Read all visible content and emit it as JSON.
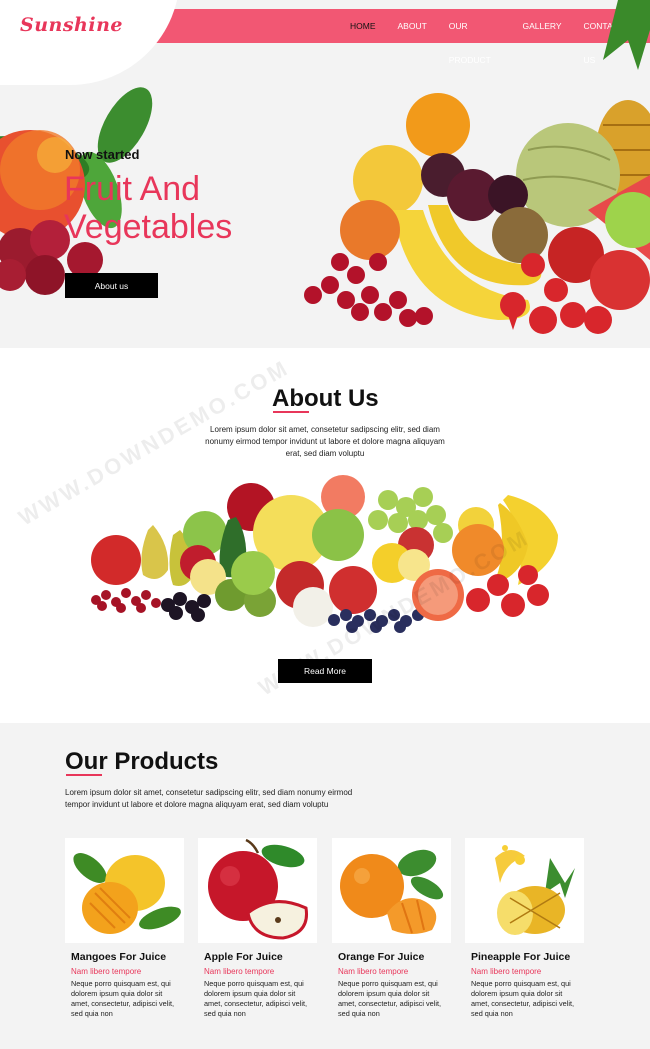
{
  "brand": {
    "logo": "Sunshine"
  },
  "nav": {
    "items": [
      {
        "label": "HOME",
        "active": true
      },
      {
        "label": "ABOUT",
        "active": false
      },
      {
        "label": "OUR PRODUCT",
        "active": false
      },
      {
        "label": "GALLERY",
        "active": false
      },
      {
        "label": "CONTACT US",
        "active": false
      }
    ]
  },
  "hero": {
    "kicker": "Now started",
    "title_line1": "Fruit And",
    "title_line2": "Vegetables",
    "button_label": "About us"
  },
  "about": {
    "title": "About Us",
    "text": "Lorem ipsum dolor sit amet, consetetur sadipscing elitr, sed diam nonumy eirmod tempor invidunt ut labore et dolore magna aliquyam erat, sed diam voluptu",
    "button_label": "Read More"
  },
  "products": {
    "title": "Our Products",
    "text": "Lorem ipsum dolor sit amet, consetetur sadipscing elitr, sed diam nonumy eirmod tempor invidunt ut labore et dolore magna aliquyam erat, sed diam voluptu",
    "items": [
      {
        "name": "Mangoes For Juice",
        "subtitle": "Nam libero tempore",
        "desc": "Neque porro quisquam est, qui dolorem ipsum quia dolor sit amet, consectetur, adipisci velit, sed quia non"
      },
      {
        "name": "Apple For Juice",
        "subtitle": "Nam libero tempore",
        "desc": "Neque porro quisquam est, qui dolorem ipsum quia dolor sit amet, consectetur, adipisci velit, sed quia non"
      },
      {
        "name": "Orange For Juice",
        "subtitle": "Nam libero tempore",
        "desc": "Neque porro quisquam est, qui dolorem ipsum quia dolor sit amet, consectetur, adipisci velit, sed quia non"
      },
      {
        "name": "Pineapple For Juice",
        "subtitle": "Nam libero tempore",
        "desc": "Neque porro quisquam est, qui dolorem ipsum quia dolor sit amet, consectetur, adipisci velit, sed quia non"
      }
    ]
  },
  "watermark": {
    "text": "WWW.DOWNDEMO.COM"
  },
  "colors": {
    "accent": "#e8365a",
    "nav_bg": "#f25773",
    "section_bg": "#f3f3f3",
    "button_bg": "#000000"
  }
}
